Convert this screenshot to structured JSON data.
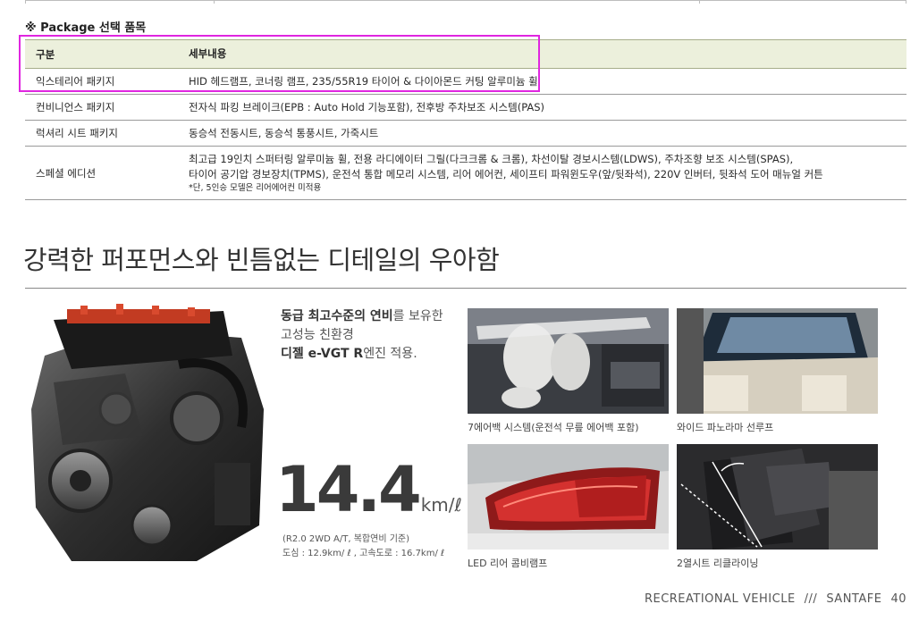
{
  "package_section": {
    "title": "※ Package 선택 품목",
    "headers": [
      "구분",
      "세부내용"
    ],
    "rows": [
      {
        "name": "익스테리어 패키지",
        "detail": "HID 헤드램프, 코너링 램프, 235/55R19 타이어 & 다이아몬드 커팅 알루미늄 휠"
      },
      {
        "name": "컨비니언스 패키지",
        "detail": "전자식 파킹 브레이크(EPB : Auto Hold 기능포함), 전후방 주차보조 시스템(PAS)"
      },
      {
        "name": "럭셔리 시트 패키지",
        "detail": "동승석 전동시트, 동승석 통풍시트, 가죽시트"
      },
      {
        "name": "스페셜 에디션",
        "detail_line1": "최고급 19인치 스퍼터링 알루미늄 휠, 전용 라디에이터 그릴(다크크롬 & 크롬), 차선이탈 경보시스템(LDWS), 주차조향 보조 시스템(SPAS),",
        "detail_line2": "타이어 공기압 경보장치(TPMS), 운전석 통합 메모리 시스템, 리어 에어컨, 세이프티 파워윈도우(앞/뒷좌석), 220V 인버터, 뒷좌석 도어 매뉴얼 커튼",
        "note": "*단, 5인승 모델은 리어에어컨 미적용"
      }
    ]
  },
  "headline": "강력한 퍼포먼스와 빈틈없는 디테일의 우아함",
  "engine_desc": {
    "line1_bold": "동급 최고수준의 연비",
    "line1_rest": "를 보유한",
    "line2": "고성능 친환경",
    "line3_bold": "디젤 e-VGT R",
    "line3_rest": "엔진 적용."
  },
  "fuel": {
    "value": "14.4",
    "unit": "km/ℓ",
    "cond1": "(R2.0 2WD A/T, 복합연비 기준)",
    "cond2": "도심 : 12.9km/ ℓ , 고속도로 : 16.7km/ ℓ"
  },
  "photos": [
    {
      "caption": "7에어백 시스템(운전석 무릎 에어백 포함)"
    },
    {
      "caption": "와이드 파노라마 선루프"
    },
    {
      "caption": "LED 리어 콤비램프"
    },
    {
      "caption": "2열시트 리클라이닝"
    }
  ],
  "footer": {
    "left": "RECREATIONAL VEHICLE",
    "sep": "///",
    "model": "SANTAFE",
    "page": "40"
  },
  "colors": {
    "table_header_bg": "#ecf0dc",
    "highlight_box": "#e026e0",
    "text": "#2a2a2a"
  }
}
